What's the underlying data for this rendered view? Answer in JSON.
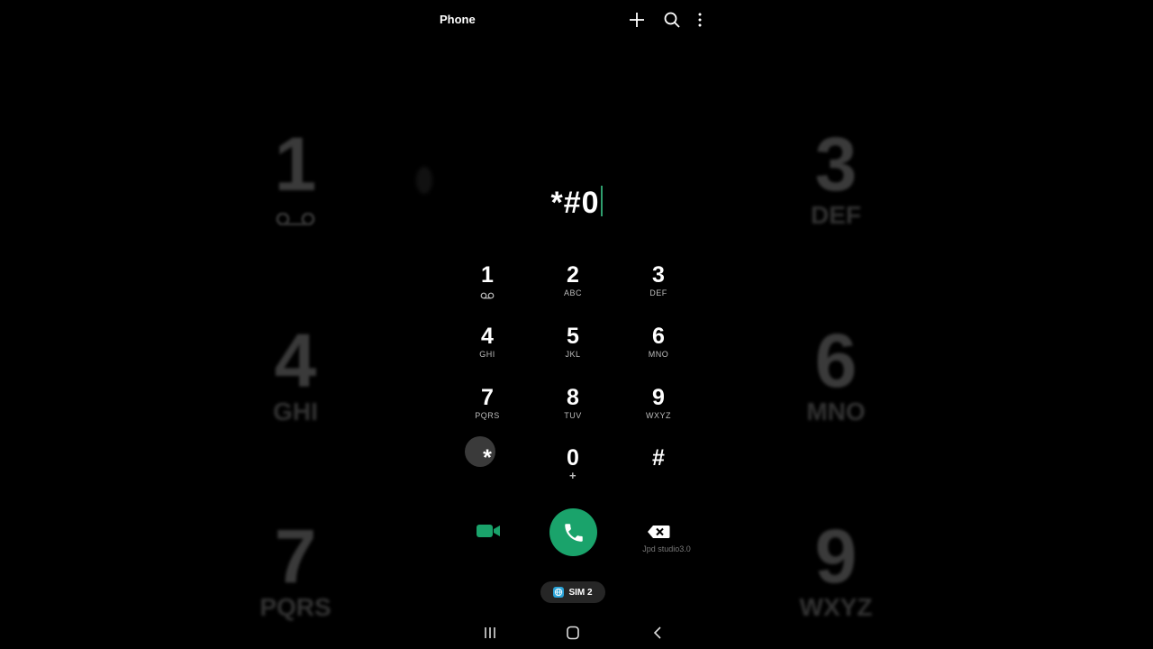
{
  "app": {
    "title": "Phone"
  },
  "toolbar": {
    "add_icon": "plus-icon",
    "search_icon": "search-icon",
    "more_icon": "more-vert-icon"
  },
  "dialer": {
    "input_value": "*#0"
  },
  "keys": [
    {
      "digit": "1",
      "letters": "",
      "icon": "voicemail-icon"
    },
    {
      "digit": "2",
      "letters": "ABC"
    },
    {
      "digit": "3",
      "letters": "DEF"
    },
    {
      "digit": "4",
      "letters": "GHI"
    },
    {
      "digit": "5",
      "letters": "JKL"
    },
    {
      "digit": "6",
      "letters": "MNO"
    },
    {
      "digit": "7",
      "letters": "PQRS"
    },
    {
      "digit": "8",
      "letters": "TUV"
    },
    {
      "digit": "9",
      "letters": "WXYZ"
    },
    {
      "digit": "*",
      "letters": ""
    },
    {
      "digit": "0",
      "letters": "+"
    },
    {
      "digit": "#",
      "letters": ""
    }
  ],
  "background_keys": [
    {
      "digit": "1",
      "letters": ""
    },
    {
      "digit": "3",
      "letters": "DEF"
    },
    {
      "digit": "4",
      "letters": "GHI"
    },
    {
      "digit": "6",
      "letters": "MNO"
    },
    {
      "digit": "7",
      "letters": "PQRS"
    },
    {
      "digit": "9",
      "letters": "WXYZ"
    }
  ],
  "actions": {
    "video_icon": "video-call-icon",
    "call_icon": "phone-icon",
    "backspace_icon": "backspace-icon"
  },
  "watermark": "Jpd studio3.0",
  "sim": {
    "label": "SIM 2"
  },
  "colors": {
    "accent": "#1aa36b",
    "background": "#000000",
    "sim_icon": "#2aa3d8"
  },
  "navbar": {
    "recents_icon": "recents-icon",
    "home_icon": "home-icon",
    "back_icon": "back-icon"
  }
}
